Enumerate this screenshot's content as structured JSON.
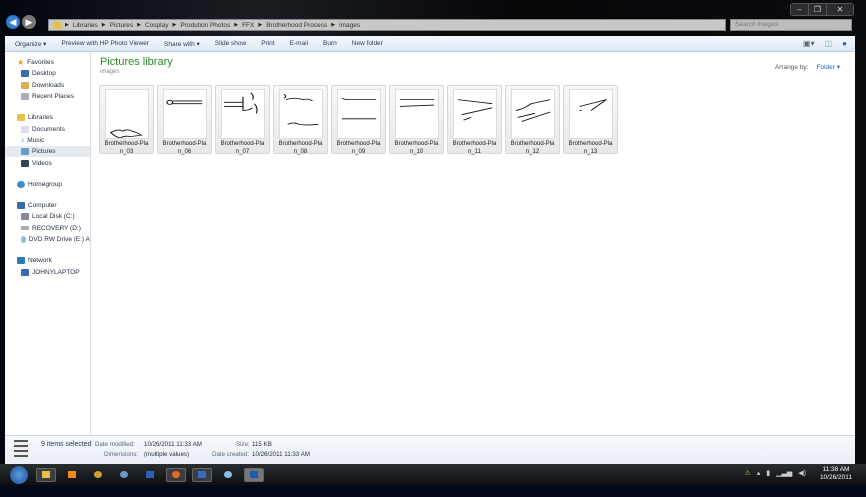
{
  "window": {
    "controls": [
      "–",
      "❐",
      "✕"
    ]
  },
  "address": {
    "crumbs": [
      "Libraries",
      "Pictures",
      "Cosplay",
      "Prodution Photos",
      "FFX",
      "Brotherhood Process",
      "images"
    ],
    "search_placeholder": "Search images"
  },
  "toolbar": {
    "items": [
      "Organize ▾",
      "Preview with HP Photo Viewer",
      "Share with ▾",
      "Slide show",
      "Print",
      "E-mail",
      "Burn",
      "New folder"
    ]
  },
  "sidebar": {
    "favorites": {
      "label": "Favorites",
      "items": [
        "Desktop",
        "Downloads",
        "Recent Places"
      ]
    },
    "libraries": {
      "label": "Libraries",
      "items": [
        "Documents",
        "Music",
        "Pictures",
        "Videos"
      ]
    },
    "homegroup": "Homegroup",
    "computer": {
      "label": "Computer",
      "items": [
        "Local Disk (C:)",
        "RECOVERY (D:)",
        "DVD RW Drive (E:) A"
      ]
    },
    "network": {
      "label": "Network",
      "items": [
        "JOHNYLAPTOP"
      ]
    }
  },
  "main": {
    "title": "Pictures library",
    "subtitle": "images",
    "arrange_label": "Arrange by:",
    "arrange_value": "Folder ▾",
    "files": [
      {
        "line1": "Brotherhood-Pla",
        "line2": "n_03"
      },
      {
        "line1": "Brotherhood-Pla",
        "line2": "n_06"
      },
      {
        "line1": "Brotherhood-Pla",
        "line2": "n_07"
      },
      {
        "line1": "Brotherhood-Pla",
        "line2": "n_08"
      },
      {
        "line1": "Brotherhood-Pla",
        "line2": "n_09"
      },
      {
        "line1": "Brotherhood-Pla",
        "line2": "n_10"
      },
      {
        "line1": "Brotherhood-Pla",
        "line2": "n_11"
      },
      {
        "line1": "Brotherhood-Pla",
        "line2": "n_12"
      },
      {
        "line1": "Brotherhood-Pla",
        "line2": "n_13"
      }
    ]
  },
  "details": {
    "selected": "9 items selected",
    "modified_label": "Date modified:",
    "modified": "10/26/2011 11:33 AM",
    "dimensions_label": "Dimensions:",
    "dimensions": "(multiple values)",
    "size_label": "Size:",
    "size": "115 KB",
    "created_label": "Date created:",
    "created": "10/26/2011 11:33 AM"
  },
  "clock": {
    "time": "11:38 AM",
    "date": "10/26/2011"
  }
}
